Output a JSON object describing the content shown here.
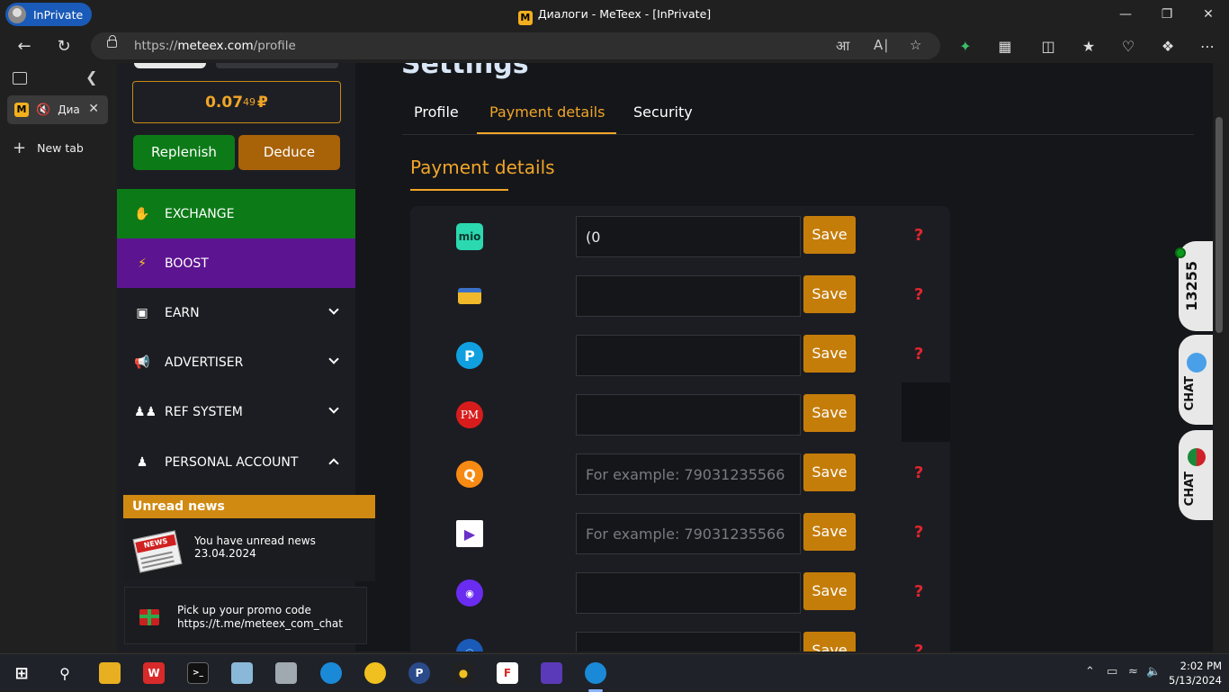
{
  "window": {
    "inprivate_label": "InPrivate",
    "title": "Диалоги - MeTeex - [InPrivate]",
    "favicon_letter": "M"
  },
  "address": {
    "url_prefix": "https://",
    "url_domain": "meteex.com",
    "url_path": "/profile"
  },
  "vertical_tabs": {
    "tab_label": "Диа",
    "new_tab_label": "New tab"
  },
  "sidebar": {
    "balance_main": "0.07",
    "balance_small": "49",
    "balance_currency": "₽",
    "replenish_label": "Replenish",
    "deduce_label": "Deduce",
    "menu": [
      {
        "label": "EXCHANGE",
        "icon": "hand-coin-icon"
      },
      {
        "label": "BOOST",
        "icon": "lightning-icon"
      },
      {
        "label": "EARN",
        "icon": "cash-icon"
      },
      {
        "label": "ADVERTISER",
        "icon": "megaphone-icon"
      },
      {
        "label": "REF SYSTEM",
        "icon": "users-icon"
      },
      {
        "label": "PERSONAL ACCOUNT",
        "icon": "person-icon"
      }
    ],
    "news_header": "Unread news",
    "news_badge": "NEWS",
    "news_text": "You have unread news",
    "news_date": "23.04.2024",
    "promo_line1": "Pick up your promo code",
    "promo_line2": "https://t.me/meteex_com_chat"
  },
  "settings": {
    "title": "Settings",
    "tabs": [
      "Profile",
      "Payment details",
      "Security"
    ],
    "section_title": "Payment details",
    "save_label": "Save",
    "help_label": "?",
    "rows": [
      {
        "icon": "mio-icon",
        "value": "(0",
        "placeholder": ""
      },
      {
        "icon": "bank-card-icon",
        "value": "",
        "placeholder": ""
      },
      {
        "icon": "payeer-icon",
        "value": "",
        "placeholder": ""
      },
      {
        "icon": "perfect-money-icon",
        "value": "",
        "placeholder": ""
      },
      {
        "icon": "qiwi-icon",
        "value": "",
        "placeholder": "For example: 79031235566"
      },
      {
        "icon": "play-wallet-icon",
        "value": "",
        "placeholder": "For example: 79031235566"
      },
      {
        "icon": "yoomoney-icon",
        "value": "",
        "placeholder": ""
      },
      {
        "icon": "webmoney-icon",
        "value": "",
        "placeholder": ""
      }
    ]
  },
  "widgets": {
    "online_count": "13255",
    "chat1_label": "CHAT",
    "chat2_label": "CHAT"
  },
  "taskbar": {
    "time": "2:02 PM",
    "date": "5/13/2024"
  }
}
